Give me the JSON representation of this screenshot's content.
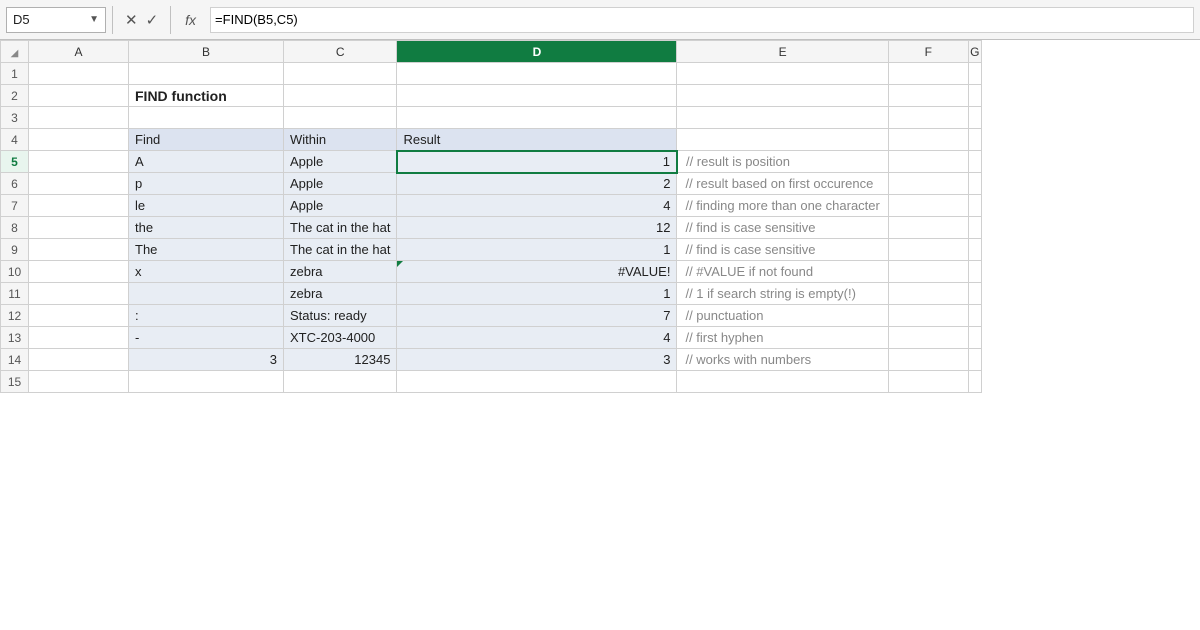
{
  "formula_bar": {
    "cell_ref": "D5",
    "formula": "=FIND(B5,C5)",
    "fx_label": "fx"
  },
  "columns": [
    "A",
    "B",
    "C",
    "D",
    "E",
    "F",
    "G"
  ],
  "title": "FIND function",
  "table": {
    "headers": [
      "Find",
      "Within",
      "Result"
    ],
    "rows": [
      {
        "find": "A",
        "within": "Apple",
        "result": "1",
        "comment": "// result is position"
      },
      {
        "find": "p",
        "within": "Apple",
        "result": "2",
        "comment": "// result based on first occurence"
      },
      {
        "find": "le",
        "within": "Apple",
        "result": "4",
        "comment": "// finding more than one character"
      },
      {
        "find": "the",
        "within": "The cat in the hat",
        "result": "12",
        "comment": "// find is case sensitive"
      },
      {
        "find": "The",
        "within": "The cat in the hat",
        "result": "1",
        "comment": "// find is case sensitive"
      },
      {
        "find": "x",
        "within": "zebra",
        "result": "#VALUE!",
        "comment": "// #VALUE if not found"
      },
      {
        "find": "",
        "within": "zebra",
        "result": "1",
        "comment": "// 1 if search string is empty(!)"
      },
      {
        "find": ":",
        "within": "Status: ready",
        "result": "7",
        "comment": "// punctuation"
      },
      {
        "find": "-",
        "within": "XTC-203-4000",
        "result": "4",
        "comment": "// first hyphen"
      },
      {
        "find": "3",
        "within": "12345",
        "result": "3",
        "comment": "// works with numbers",
        "find_is_num": true,
        "within_is_num": true
      }
    ]
  },
  "active_cell": "D5",
  "active_column": "D",
  "active_row": 5
}
